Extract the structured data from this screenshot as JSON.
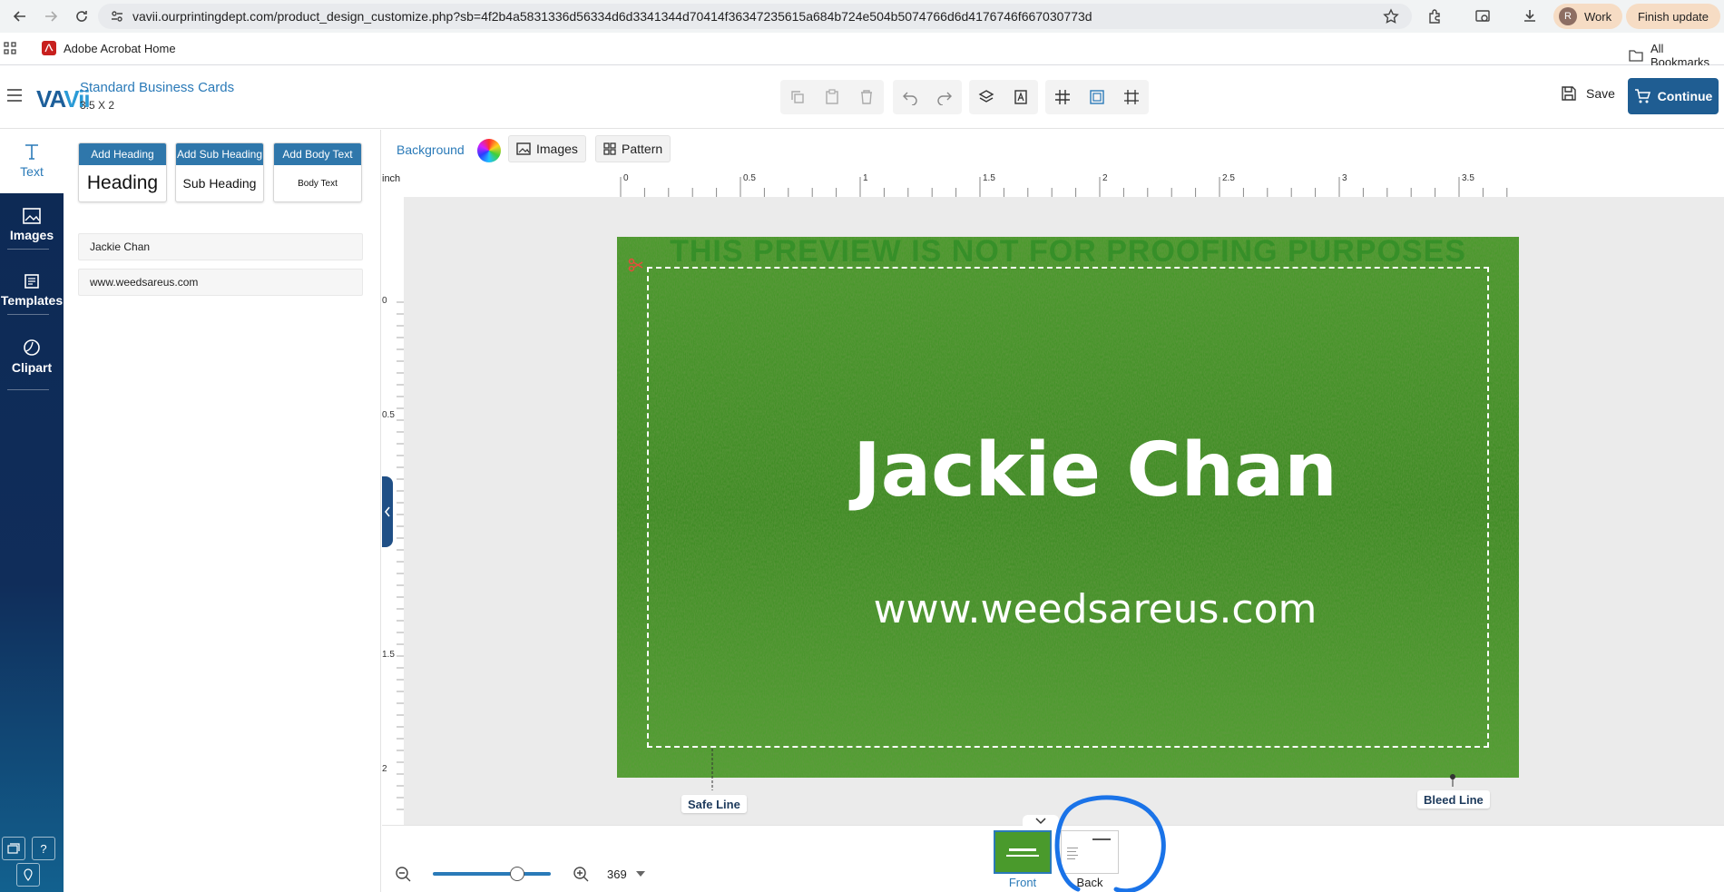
{
  "browser": {
    "url": "vavii.ourprintingdept.com/product_design_customize.php?sb=4f2b4a5831336d56334d6d3341344d70414f36347235615a684b724e504b5074766d6d4176746f667030773d",
    "bookmark_label": "Adobe Acrobat Home",
    "all_bookmarks_label": "All Bookmarks",
    "profile_label": "Work",
    "profile_initial": "R",
    "update_label": "Finish update"
  },
  "header": {
    "logo_main": "VA",
    "logo_accent": "Vii",
    "product_title": "Standard Business Cards",
    "product_size": "3.5 X 2",
    "save_label": "Save",
    "continue_label": "Continue"
  },
  "rail": {
    "items": [
      {
        "label": "Text",
        "icon": "text-icon"
      },
      {
        "label": "Images",
        "icon": "image-icon"
      },
      {
        "label": "Templates",
        "icon": "templates-icon"
      },
      {
        "label": "Clipart",
        "icon": "clipart-icon"
      }
    ]
  },
  "panel": {
    "cards": [
      {
        "button": "Add Heading",
        "sample": "Heading"
      },
      {
        "button": "Add Sub Heading",
        "sample": "Sub Heading"
      },
      {
        "button": "Add Body Text",
        "sample": "Body Text"
      }
    ],
    "fields": [
      "Jackie Chan",
      "www.weedsareus.com"
    ]
  },
  "canvas": {
    "background_label": "Background",
    "images_label": "Images",
    "pattern_label": "Pattern",
    "unit": "inch",
    "h_ticks": [
      "0",
      "0.5",
      "1",
      "1.5",
      "2",
      "2.5",
      "3",
      "3.5"
    ],
    "v_ticks": [
      "0",
      "0.5",
      "1.5",
      "2"
    ],
    "watermark": "THIS PREVIEW IS NOT FOR PROOFING PURPOSES",
    "card_name": "Jackie Chan",
    "card_url": "www.weedsareus.com",
    "safe_line_label": "Safe Line",
    "bleed_line_label": "Bleed Line"
  },
  "bottom": {
    "zoom_value": "369",
    "pages": [
      "Front",
      "Back"
    ]
  },
  "colors": {
    "brand": "#1f5d92",
    "accent": "#2a7ab8",
    "annotation": "#1a73e8"
  }
}
